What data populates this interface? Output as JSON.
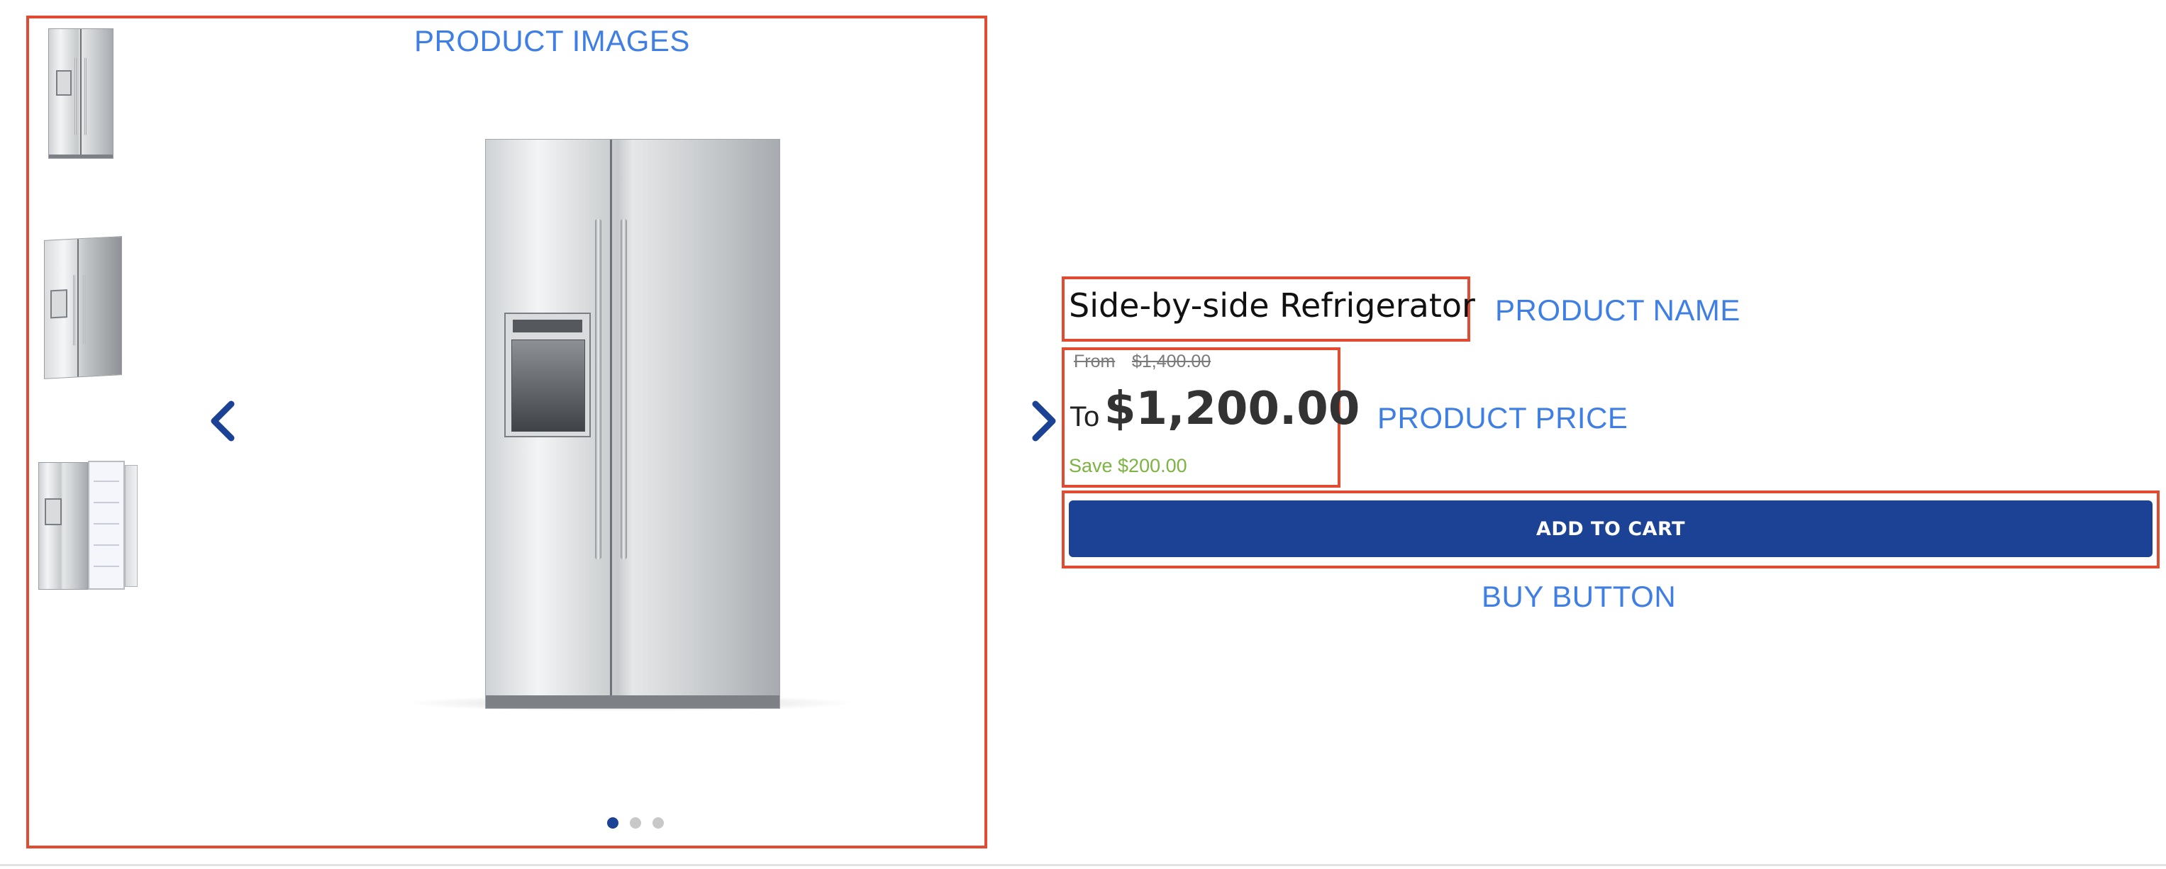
{
  "annotations": {
    "product_images": "PRODUCT IMAGES",
    "product_name": "PRODUCT NAME",
    "product_price": "PRODUCT PRICE",
    "buy_button": "BUY BUTTON"
  },
  "gallery": {
    "thumbnails": [
      "thumbnail-front",
      "thumbnail-angled",
      "thumbnail-open"
    ],
    "prev_icon": "chevron-left-icon",
    "next_icon": "chevron-right-icon",
    "dots": 3,
    "active_dot": 0
  },
  "product": {
    "name": "Side-by-side Refrigerator",
    "from_label": "From",
    "original_price": "$1,400.00",
    "to_label": "To",
    "price": "$1,200.00",
    "savings": "Save $200.00",
    "add_to_cart": "ADD TO CART"
  },
  "colors": {
    "annotation_border": "#e14b32",
    "annotation_text": "#3f7fe3",
    "brand_blue": "#1b4294",
    "savings_green": "#7cb342",
    "dot_inactive": "#c8c8c8"
  }
}
